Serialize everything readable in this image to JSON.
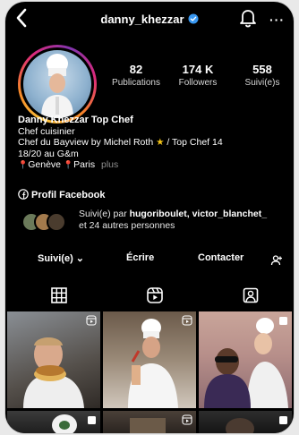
{
  "header": {
    "username": "danny_khezzar",
    "more": "···"
  },
  "stats": [
    {
      "value": "82",
      "label": "Publications"
    },
    {
      "value": "174 K",
      "label": "Followers"
    },
    {
      "value": "558",
      "label": "Suivi(e)s"
    }
  ],
  "bio": {
    "name": "Danny Khezzar Top Chef",
    "category": "Chef cuisinier",
    "line1": "Chef du Bayview by Michel Roth",
    "line1_tail": " / Top Chef 14",
    "line2": "18/20 au G&m",
    "loc1": "Genève",
    "loc2": "Paris",
    "more": "plus"
  },
  "facebook": {
    "label": "Profil Facebook"
  },
  "mutual": {
    "prefix": "Suivi(e) par ",
    "names": "hugoriboulet, victor_blanchet_",
    "suffix": "et 24 autres personnes"
  },
  "actions": {
    "follow": "Suivi(e) ⌄",
    "message": "Écrire",
    "contact": "Contacter"
  },
  "colors": {
    "background": "#000000",
    "verified": "#3897f0",
    "muted": "#8e8e8e"
  },
  "icons": [
    "back-icon",
    "verified-icon",
    "bell-icon",
    "facebook-icon",
    "add-user-icon",
    "grid-icon",
    "reels-icon",
    "tagged-icon",
    "reel-icon"
  ]
}
